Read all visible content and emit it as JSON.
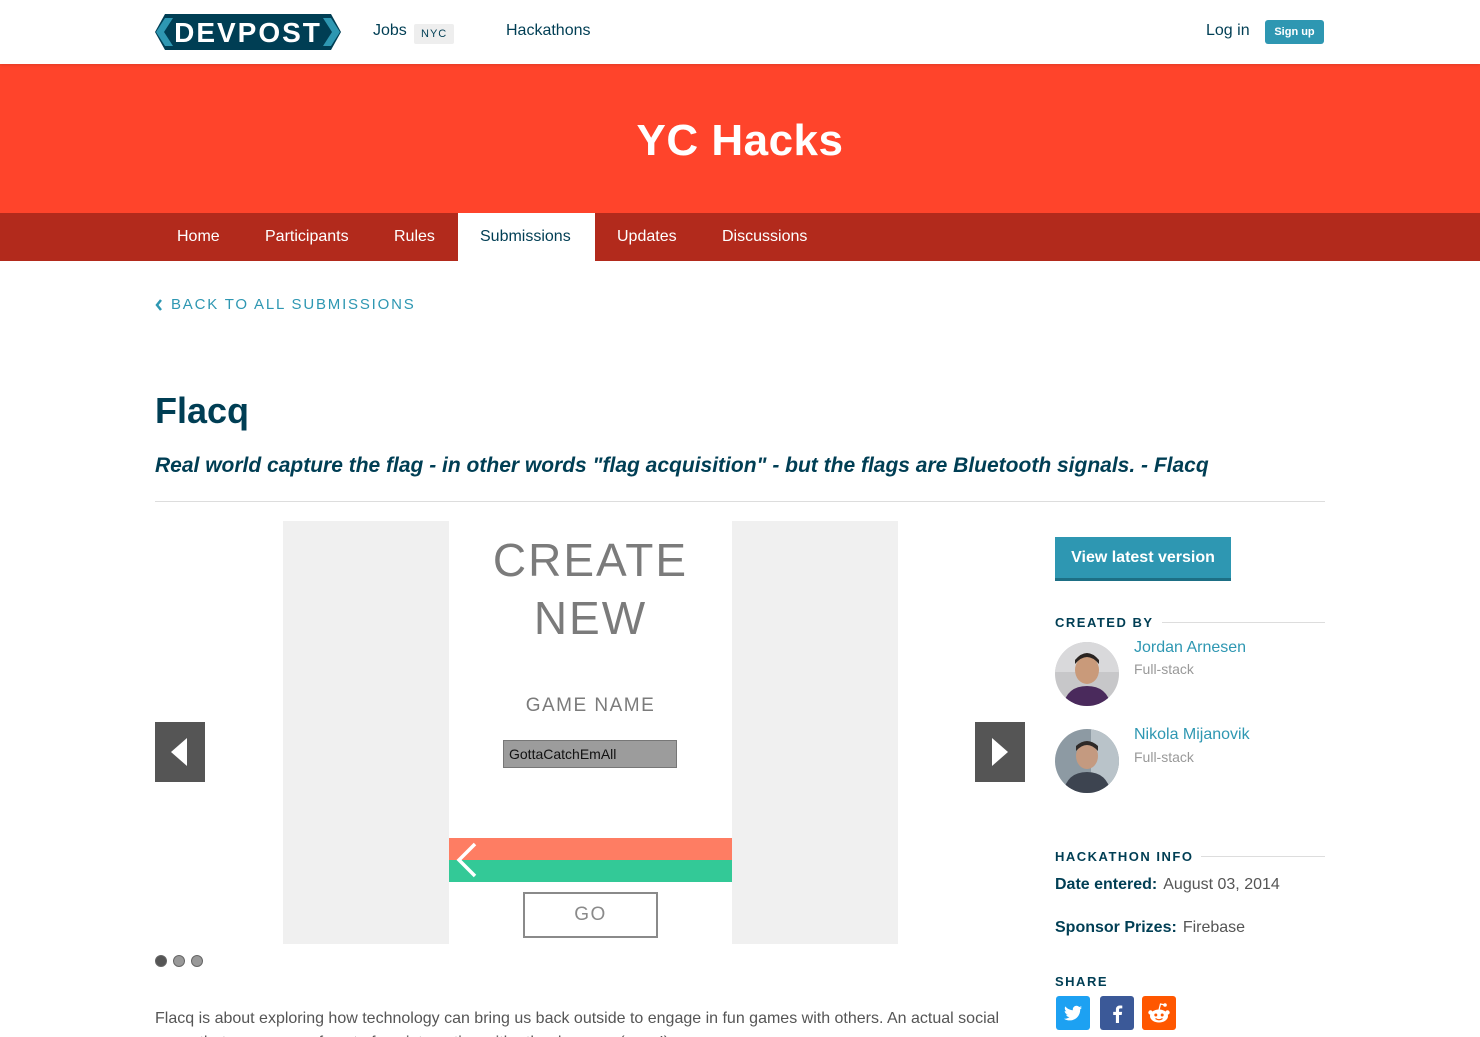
{
  "nav": {
    "logo_text": "DEVPOST",
    "jobs": "Jobs",
    "jobs_badge": "NYC",
    "hackathons": "Hackathons",
    "login": "Log in",
    "signup": "Sign up"
  },
  "banner": {
    "title": "YC Hacks",
    "color": "#ff442b"
  },
  "tabs": [
    {
      "label": "Home"
    },
    {
      "label": "Participants"
    },
    {
      "label": "Rules"
    },
    {
      "label": "Submissions",
      "active": true
    },
    {
      "label": "Updates"
    },
    {
      "label": "Discussions"
    }
  ],
  "back_link": "BACK TO ALL SUBMISSIONS",
  "project": {
    "title": "Flacq",
    "tagline": "Real world capture the flag - in other words \"flag acquisition\" - but the flags are Bluetooth signals. - Flacq",
    "description": "Flacq is about exploring how technology can bring us back outside to engage in fun games with others. An actual social game that encourages face to face interaction with other humans (gasp!)."
  },
  "gallery": {
    "screen_title_line1": "CREATE",
    "screen_title_line2": "NEW",
    "game_name_label": "GAME NAME",
    "game_name_value": "GottaCatchEmAll",
    "go_label": "GO",
    "slide_count": 3,
    "active_slide": 1,
    "stripe_colors": [
      "#fe7d63",
      "#33c997"
    ]
  },
  "sidebar": {
    "view_latest": "View latest version",
    "created_by": "CREATED BY",
    "members": [
      {
        "name": "Jordan Arnesen",
        "role": "Full-stack",
        "avatar": "avatar-photo"
      },
      {
        "name": "Nikola Mijanovik",
        "role": "Full-stack",
        "avatar": "avatar-photo"
      }
    ],
    "hackathon_info": "HACKATHON INFO",
    "date_label": "Date entered:",
    "date_value": "August 03, 2014",
    "prizes_label": "Sponsor Prizes:",
    "prizes_value": "Firebase",
    "share": "SHARE",
    "share_icons": [
      "twitter-icon",
      "facebook-icon",
      "reddit-icon"
    ]
  },
  "colors": {
    "primary": "#003e54",
    "accent": "#2e97b2",
    "tabbar": "#b22a1c"
  }
}
